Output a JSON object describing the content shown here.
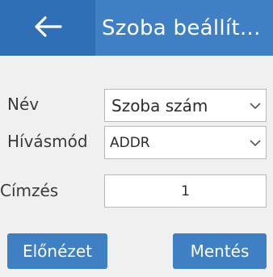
{
  "header": {
    "back_icon": "arrow-left-icon",
    "title": "Szoba beállít..."
  },
  "form": {
    "name": {
      "label": "Név",
      "value": "Szoba szám",
      "icon": "chevron-down-icon"
    },
    "call_mode": {
      "label": "Hívásmód",
      "value": "ADDR",
      "icon": "chevron-down-icon"
    },
    "address": {
      "label": "Címzés",
      "value": "1"
    }
  },
  "actions": {
    "preview_label": "Előnézet",
    "save_label": "Mentés"
  },
  "colors": {
    "header": "#3f7fc4",
    "back_button": "#2f6fb6",
    "background": "#f0f0f0",
    "button": "#3f7fc4"
  }
}
